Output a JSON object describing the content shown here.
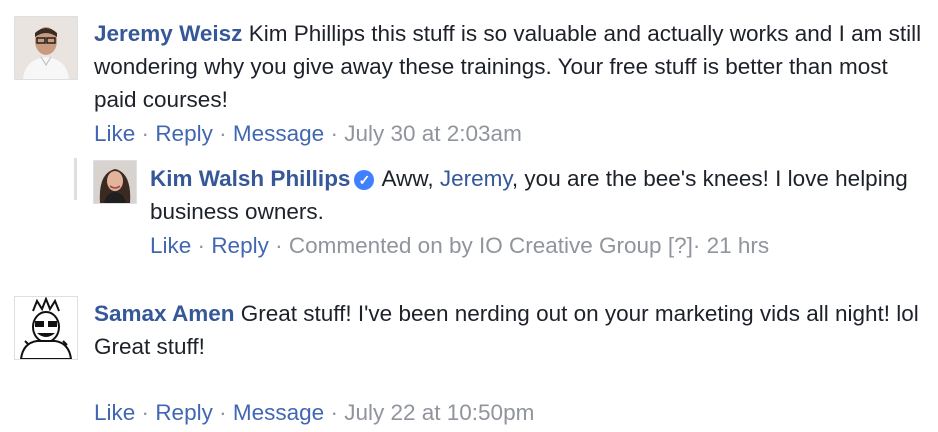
{
  "comments": [
    {
      "author": "Jeremy Weisz",
      "text": "Kim Phillips this stuff is so valuable and actually works and I am still wondering why you give away these trainings. Your free stuff is better than most paid courses!",
      "actions": {
        "like": "Like",
        "reply": "Reply",
        "message": "Message",
        "timestamp": "July 30 at 2:03am"
      },
      "reply": {
        "author": "Kim Walsh Phillips",
        "text_before": "Aww, ",
        "mention": "Jeremy",
        "text_after": ", you are the bee's knees! I love helping business owners.",
        "actions": {
          "like": "Like",
          "reply": "Reply",
          "commented_on_by": "Commented on by IO Creative Group",
          "help": "[?]",
          "timestamp": "21 hrs"
        }
      }
    },
    {
      "author": "Samax Amen",
      "text_line1": "Great stuff! I've been nerding out on your marketing vids all night! lol",
      "text_line2": "Great stuff!",
      "actions": {
        "like": "Like",
        "reply": "Reply",
        "message": "Message",
        "timestamp": "July 22 at 10:50pm"
      }
    }
  ],
  "separator": "·",
  "colors": {
    "link": "#365899",
    "meta": "#90949c",
    "verified": "#4080ff"
  }
}
